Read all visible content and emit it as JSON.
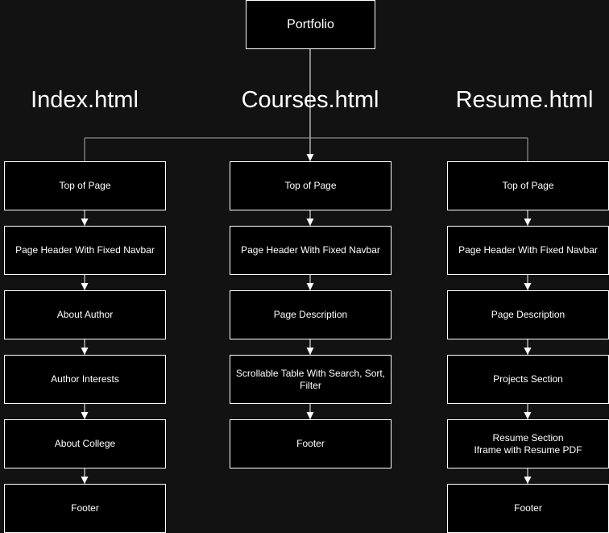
{
  "root": {
    "label": "Portfolio"
  },
  "columns": [
    {
      "heading": "Index.html",
      "boxes": [
        "Top of Page",
        "Page Header With Fixed Navbar",
        "About Author",
        "Author Interests",
        "About College",
        "Footer"
      ]
    },
    {
      "heading": "Courses.html",
      "boxes": [
        "Top of Page",
        "Page Header With Fixed Navbar",
        "Page Description",
        "Scrollable Table With Search, Sort, Filter",
        "Footer"
      ]
    },
    {
      "heading": "Resume.html",
      "boxes": [
        "Top of Page",
        "Page Header With Fixed Navbar",
        "Page Description",
        "Projects Section",
        "Resume Section\nIframe with Resume PDF",
        "Footer"
      ]
    }
  ],
  "colors": {
    "background": "#121212",
    "box_fill": "#000000",
    "line": "#ffffff"
  }
}
